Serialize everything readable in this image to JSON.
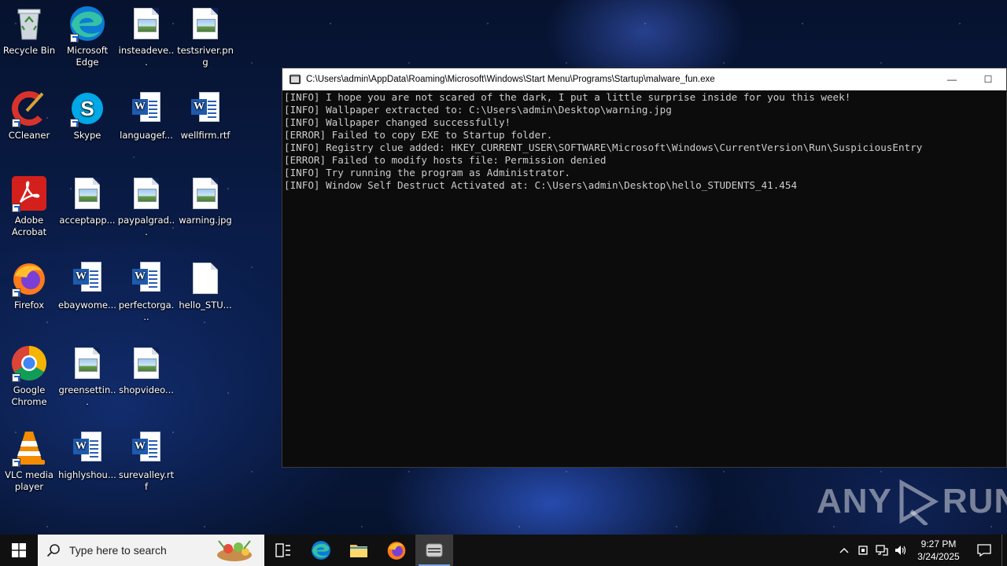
{
  "desktop": {
    "icons": [
      {
        "label": "Recycle Bin",
        "icon": "recycle-bin-icon"
      },
      {
        "label": "Microsoft Edge",
        "icon": "edge-icon"
      },
      {
        "label": "insteadeve...",
        "icon": "image-file-icon"
      },
      {
        "label": "testsriver.png",
        "icon": "image-file-icon"
      },
      {
        "label": "CCleaner",
        "icon": "ccleaner-icon"
      },
      {
        "label": "Skype",
        "icon": "skype-icon"
      },
      {
        "label": "languagef...",
        "icon": "word-doc-icon"
      },
      {
        "label": "wellfirm.rtf",
        "icon": "word-doc-icon"
      },
      {
        "label": "Adobe Acrobat",
        "icon": "acrobat-icon"
      },
      {
        "label": "acceptapp...",
        "icon": "image-file-icon"
      },
      {
        "label": "paypalgrad...",
        "icon": "image-file-icon"
      },
      {
        "label": "warning.jpg",
        "icon": "image-file-icon"
      },
      {
        "label": "Firefox",
        "icon": "firefox-icon"
      },
      {
        "label": "ebaywome...",
        "icon": "word-doc-icon"
      },
      {
        "label": "perfectorga...",
        "icon": "word-doc-icon"
      },
      {
        "label": "hello_STU...",
        "icon": "blank-file-icon"
      },
      {
        "label": "Google Chrome",
        "icon": "chrome-icon"
      },
      {
        "label": "greensettin...",
        "icon": "image-file-icon"
      },
      {
        "label": "shopvideo...",
        "icon": "image-file-icon"
      },
      {
        "label": "VLC media player",
        "icon": "vlc-icon"
      },
      {
        "label": "highlyshou...",
        "icon": "word-doc-icon"
      },
      {
        "label": "surevalley.rtf",
        "icon": "word-doc-icon"
      }
    ]
  },
  "console": {
    "title": "C:\\Users\\admin\\AppData\\Roaming\\Microsoft\\Windows\\Start Menu\\Programs\\Startup\\malware_fun.exe",
    "minimize": "—",
    "maximize": "☐",
    "lines": [
      "[INFO] I hope you are not scared of the dark, I put a little surprise inside for you this week!",
      "[INFO] Wallpaper extracted to: C:\\Users\\admin\\Desktop\\warning.jpg",
      "[INFO] Wallpaper changed successfully!",
      "[ERROR] Failed to copy EXE to Startup folder.",
      "[INFO] Registry clue added: HKEY_CURRENT_USER\\SOFTWARE\\Microsoft\\Windows\\CurrentVersion\\Run\\SuspiciousEntry",
      "[ERROR] Failed to modify hosts file: Permission denied",
      "[INFO] Try running the program as Administrator.",
      "[INFO] Window Self Destruct Activated at: C:\\Users\\admin\\Desktop\\hello_STUDENTS_41.454"
    ]
  },
  "watermark": {
    "left": "ANY",
    "right": "RUN"
  },
  "taskbar": {
    "search_placeholder": "Type here to search",
    "clock_time": "9:27 PM",
    "clock_date": "3/24/2025"
  }
}
